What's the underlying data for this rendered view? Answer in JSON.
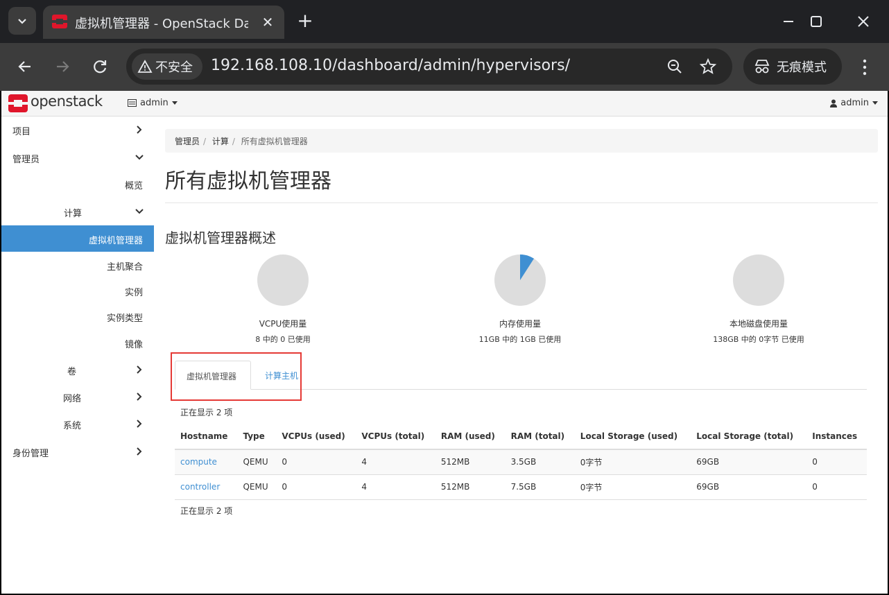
{
  "browser": {
    "tab_title": "虚拟机管理器 - OpenStack Dashboard",
    "security_label": "不安全",
    "url": "192.168.108.10/dashboard/admin/hypervisors/",
    "incognito_label": "无痕模式"
  },
  "topnav": {
    "logo_text": "openstack",
    "project": "admin",
    "user": "admin"
  },
  "sidebar": {
    "items": [
      {
        "label": "项目"
      },
      {
        "label": "管理员"
      },
      {
        "label": "概览"
      },
      {
        "label": "计算"
      },
      {
        "label": "虚拟机管理器"
      },
      {
        "label": "主机聚合"
      },
      {
        "label": "实例"
      },
      {
        "label": "实例类型"
      },
      {
        "label": "镜像"
      },
      {
        "label": "卷"
      },
      {
        "label": "网络"
      },
      {
        "label": "系统"
      },
      {
        "label": "身份管理"
      }
    ]
  },
  "breadcrumb": [
    "管理员",
    "计算",
    "所有虚拟机管理器"
  ],
  "page_title": "所有虚拟机管理器",
  "section_title": "虚拟机管理器概述",
  "usage": [
    {
      "label": "VCPU使用量",
      "detail": "8 中的 0 已使用",
      "used": 0,
      "total": 8
    },
    {
      "label": "内存使用量",
      "detail": "11GB 中的 1GB 已使用",
      "used": 1,
      "total": 11
    },
    {
      "label": "本地磁盘使用量",
      "detail": "138GB 中的 0字节 已使用",
      "used": 0,
      "total": 138
    }
  ],
  "tabs": [
    "虚拟机管理器",
    "计算主机"
  ],
  "count_text": "正在显示 2 项",
  "table": {
    "headers": [
      "Hostname",
      "Type",
      "VCPUs (used)",
      "VCPUs (total)",
      "RAM (used)",
      "RAM (total)",
      "Local Storage (used)",
      "Local Storage (total)",
      "Instances"
    ],
    "rows": [
      [
        "compute",
        "QEMU",
        "0",
        "4",
        "512MB",
        "3.5GB",
        "0字节",
        "69GB",
        "0"
      ],
      [
        "controller",
        "QEMU",
        "0",
        "4",
        "512MB",
        "7.5GB",
        "0字节",
        "69GB",
        "0"
      ]
    ]
  },
  "colors": {
    "accent": "#3f8fd2",
    "pie_bg": "#dddddd",
    "highlight": "#e53935"
  }
}
